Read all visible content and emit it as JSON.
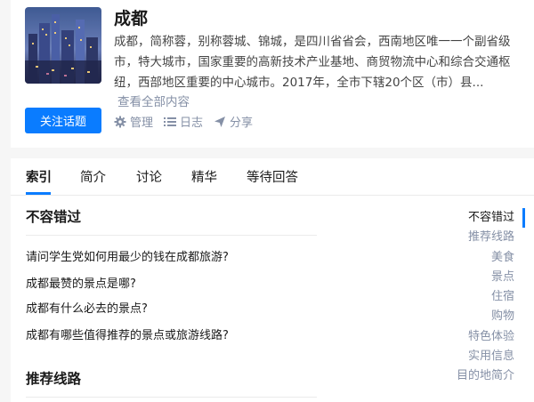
{
  "topic": {
    "title": "成都",
    "description_lines": [
      "成都，简称蓉，别称蓉城、锦城，是四川省省会，西南地区唯一一个副省级",
      "市，特大城市，国家重要的高新技术产业基地、商贸物流中心和综合交通枢",
      "纽，西部地区重要的中心城市。2017年，全市下辖20个区（市）县..."
    ],
    "more_label": "查看全部内容",
    "follow_label": "关注话题",
    "manage_label": "管理",
    "log_label": "日志",
    "share_label": "分享"
  },
  "tabs": [
    {
      "label": "索引",
      "active": true
    },
    {
      "label": "简介",
      "active": false
    },
    {
      "label": "讨论",
      "active": false
    },
    {
      "label": "精华",
      "active": false
    },
    {
      "label": "等待回答",
      "active": false
    }
  ],
  "sections": [
    {
      "title": "不容错过",
      "questions": [
        "请问学生党如何用最少的钱在成都旅游?",
        "成都最赞的景点是哪?",
        "成都有什么必去的景点?",
        "成都有哪些值得推荐的景点或旅游线路?"
      ]
    },
    {
      "title": "推荐线路",
      "questions": []
    }
  ],
  "toc": [
    {
      "label": "不容错过",
      "active": true
    },
    {
      "label": "推荐线路",
      "active": false
    },
    {
      "label": "美食",
      "active": false
    },
    {
      "label": "景点",
      "active": false
    },
    {
      "label": "住宿",
      "active": false
    },
    {
      "label": "购物",
      "active": false
    },
    {
      "label": "特色体验",
      "active": false
    },
    {
      "label": "实用信息",
      "active": false
    },
    {
      "label": "目的地简介",
      "active": false
    }
  ],
  "colors": {
    "accent": "#0a7cff",
    "muted": "#8590a6",
    "text": "#1a1a1a"
  }
}
